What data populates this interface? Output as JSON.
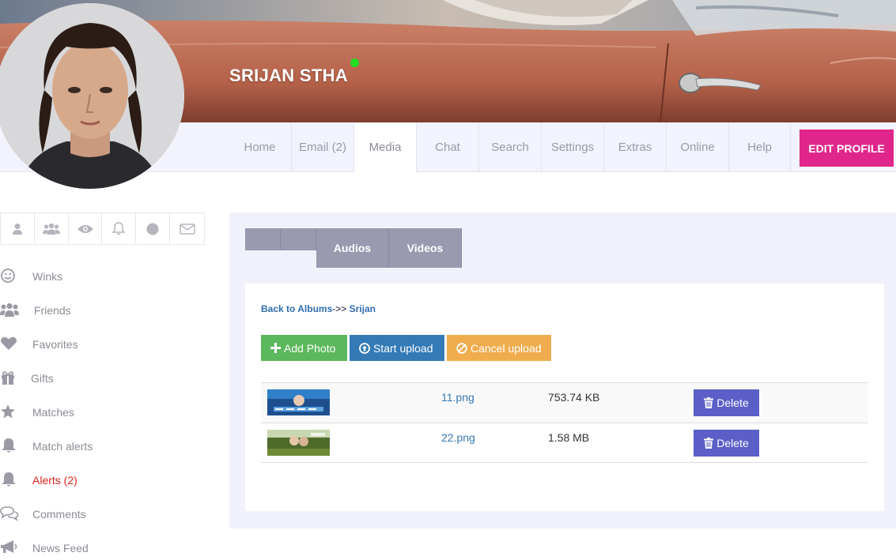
{
  "profile": {
    "name": "SRIJAN STHA"
  },
  "nav": {
    "items": [
      {
        "label": "Home"
      },
      {
        "label": "Email (2)"
      },
      {
        "label": "Media"
      },
      {
        "label": "Chat"
      },
      {
        "label": "Search"
      },
      {
        "label": "Settings"
      },
      {
        "label": "Extras"
      },
      {
        "label": "Online"
      },
      {
        "label": "Help"
      }
    ],
    "active": "Media",
    "edit_profile_label": "EDIT PROFILE"
  },
  "icon_bar": [
    "user-icon",
    "users-icon",
    "eye-icon",
    "bell-icon",
    "circle-icon",
    "envelope-icon"
  ],
  "sidebar": {
    "items": [
      {
        "label": "Winks",
        "icon": "smile-icon"
      },
      {
        "label": "Friends",
        "icon": "users-icon"
      },
      {
        "label": "Favorites",
        "icon": "heart-icon"
      },
      {
        "label": "Gifts",
        "icon": "gift-icon"
      },
      {
        "label": "Matches",
        "icon": "star-icon"
      },
      {
        "label": "Match alerts",
        "icon": "bell-icon"
      },
      {
        "label": "Alerts (2)",
        "icon": "bell-icon"
      },
      {
        "label": "Comments",
        "icon": "comments-icon"
      },
      {
        "label": "News Feed",
        "icon": "bullhorn-icon"
      }
    ]
  },
  "media": {
    "tabs": [
      {
        "label": ""
      },
      {
        "label": ""
      },
      {
        "label": "Audios"
      },
      {
        "label": "Videos"
      }
    ],
    "breadcrumb": {
      "back_label": "Back to Albums",
      "separator": "->>",
      "album": "Srijan"
    },
    "buttons": {
      "add": "Add Photo",
      "start": "Start upload",
      "cancel": "Cancel upload"
    },
    "files": [
      {
        "name": "11.png",
        "size": "753.74 KB",
        "delete_label": "Delete"
      },
      {
        "name": "22.png",
        "size": "1.58 MB",
        "delete_label": "Delete"
      }
    ]
  },
  "colors": {
    "accent_pink": "#e0268b",
    "success": "#5cb85c",
    "primary": "#337ab7",
    "warning": "#f0ad4e",
    "delete": "#5b5fc7",
    "alert_text": "#e2231a",
    "online": "#22dd22"
  }
}
